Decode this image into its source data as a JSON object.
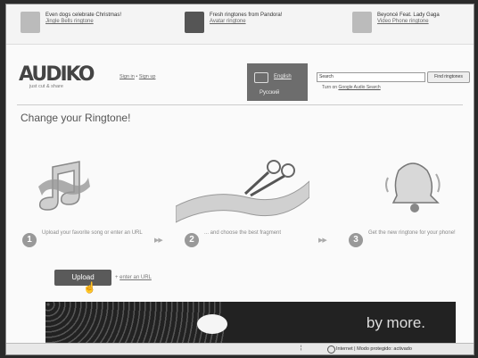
{
  "promo": [
    {
      "line1": "Even dogs celebrate Christmas!",
      "link": "Jingle Bells ringtone"
    },
    {
      "line1": "Fresh ringtones from Pandora!",
      "link": "Avatar ringtone"
    },
    {
      "line1": "Beyoncé Feat. Lady Gaga",
      "link": "Video Phone ringtone"
    }
  ],
  "header": {
    "logo_text": "AUDIKO",
    "logo_tagline": "just cut & share",
    "sign_in": "Sign in",
    "sign_sep": " • ",
    "sign_up": "Sign up",
    "lang_primary": "English",
    "lang_secondary": "Русский",
    "search_value": "Search",
    "search_button": "Find ringtones",
    "search_sub_prefix": "Turn on ",
    "search_sub_link": "Google Audio Search"
  },
  "main": {
    "title": "Change your Ringtone!",
    "steps": [
      {
        "num": "1",
        "text": "Upload your favorite song or enter an URL"
      },
      {
        "num": "2",
        "text": "... and choose the best fragment"
      },
      {
        "num": "3",
        "text": "Get the new ringtone for your phone!"
      }
    ],
    "arrow": "▶▶",
    "upload_label": "Upload",
    "enter_url_prefix": "+ ",
    "enter_url_link": "enter an URL",
    "banner_text": "by more."
  },
  "status": {
    "zone_text": "Internet | Modo protegido: activado"
  }
}
